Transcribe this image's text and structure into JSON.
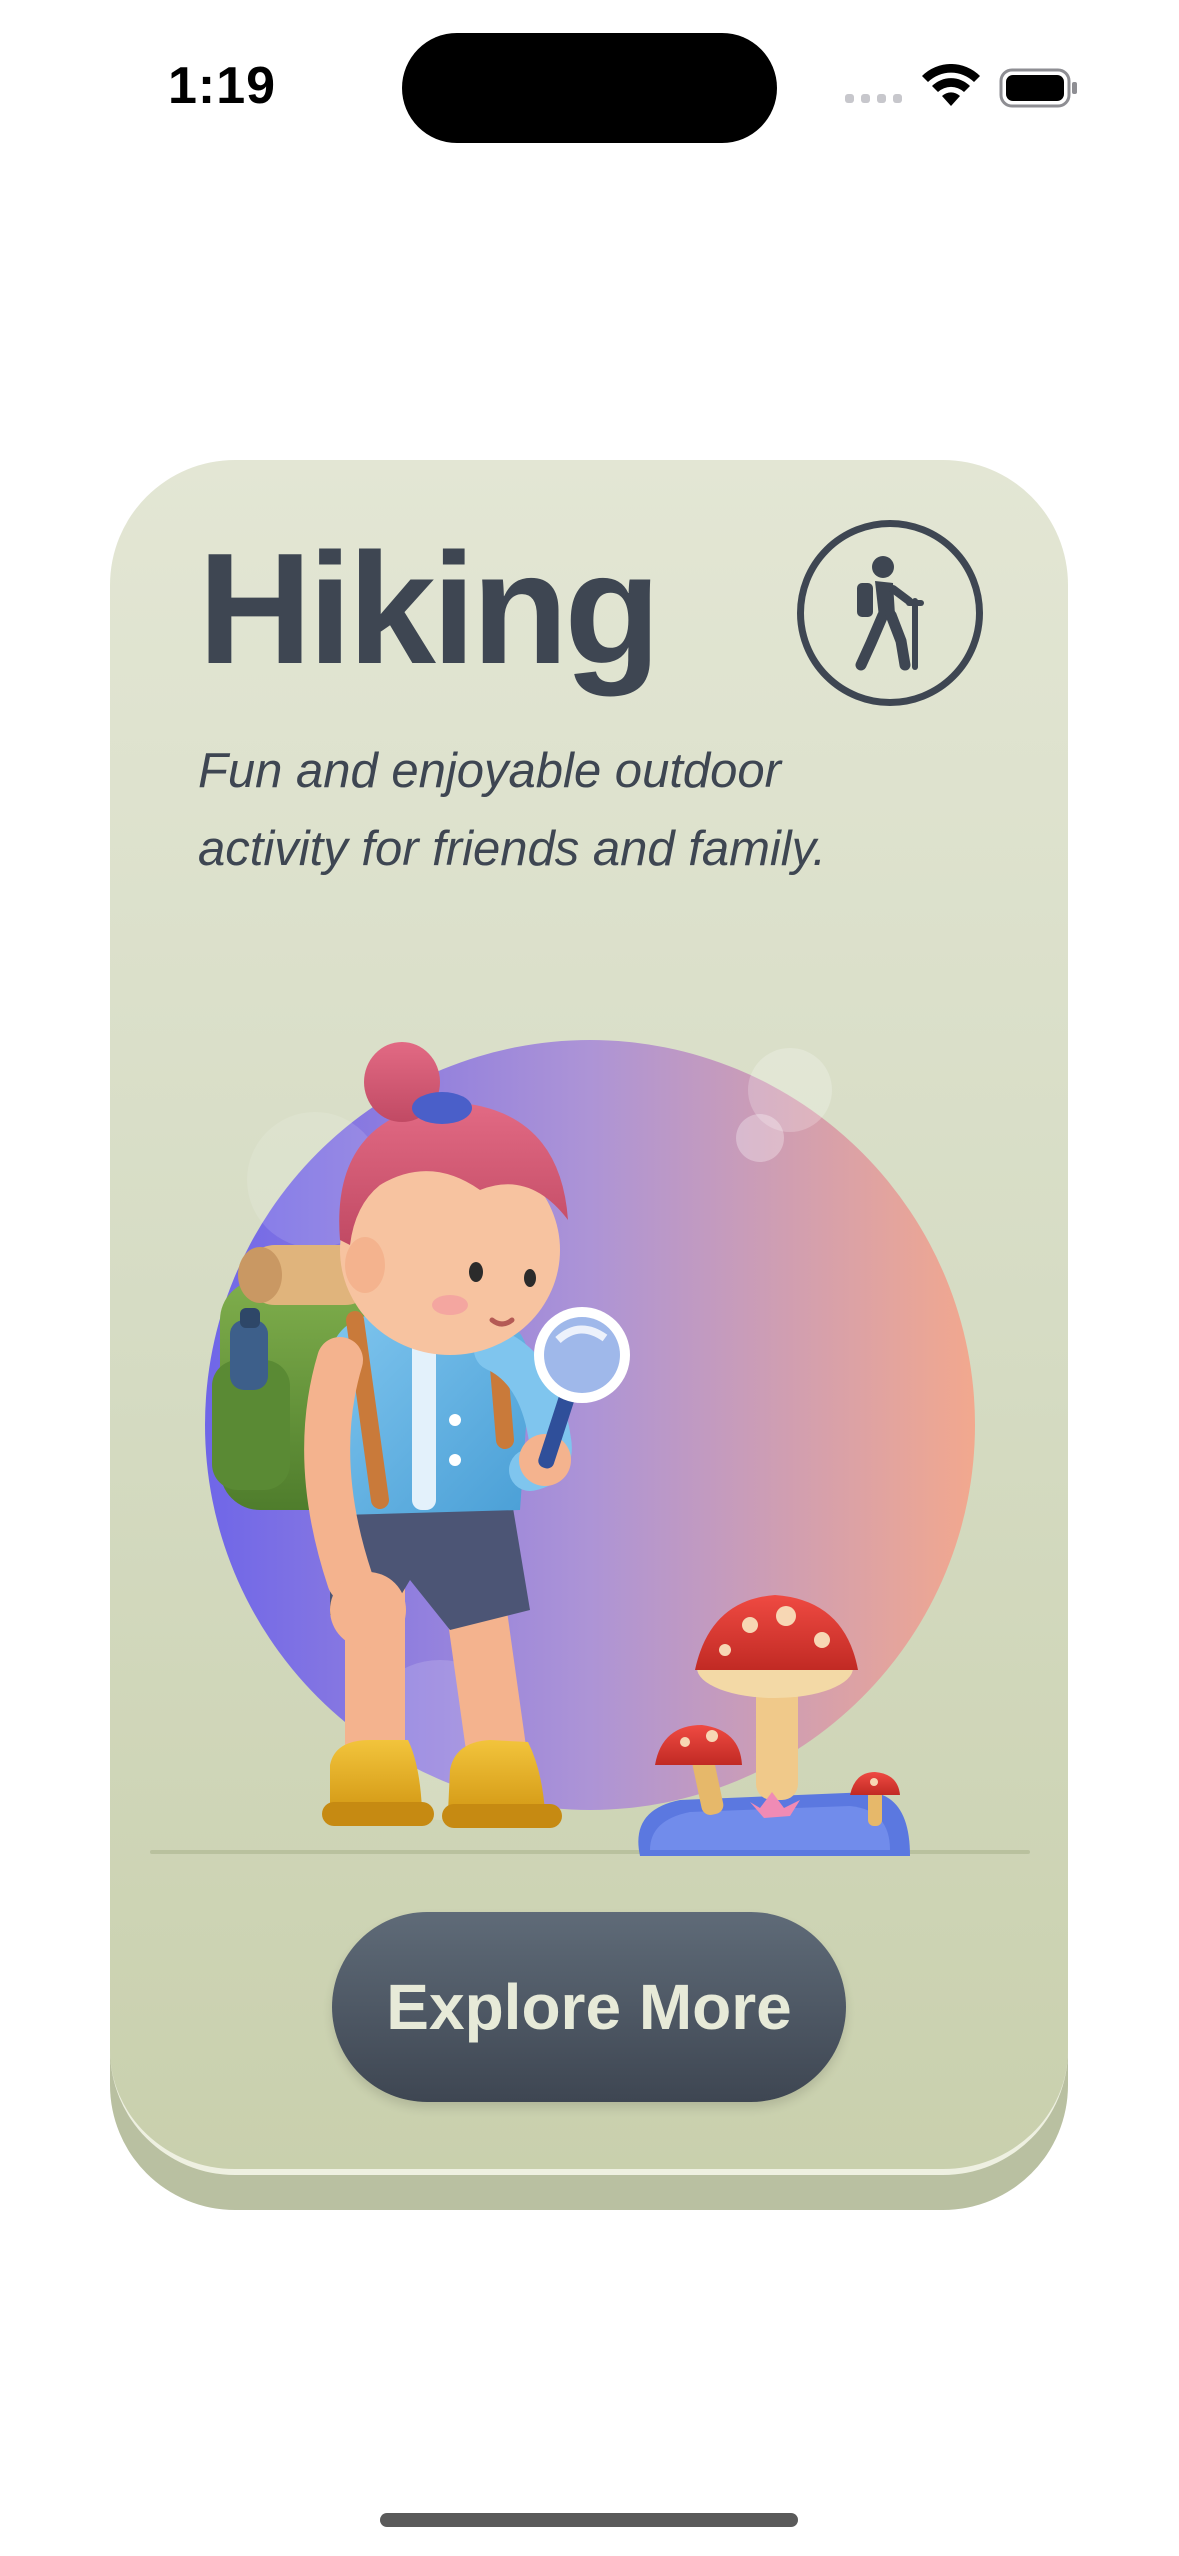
{
  "status_bar": {
    "time": "1:19"
  },
  "card": {
    "title": "Hiking",
    "subtitle_lines": [
      "Fun and enjoyable outdoor",
      "activity for friends and family."
    ],
    "badge_icon": "hiker-icon",
    "button_label": "Explore More"
  },
  "colors": {
    "card_top": "#e3e6d4",
    "card_bottom": "#c9d0ad",
    "text_dark": "#3e4652",
    "button_bg": "#4a5460",
    "button_text": "#e7ead8",
    "orb_left": "#6f66e8",
    "orb_right": "#f2a88e"
  },
  "icons": {
    "wifi": "wifi-icon",
    "battery": "battery-icon",
    "signal": "cellular-signal-icon"
  }
}
